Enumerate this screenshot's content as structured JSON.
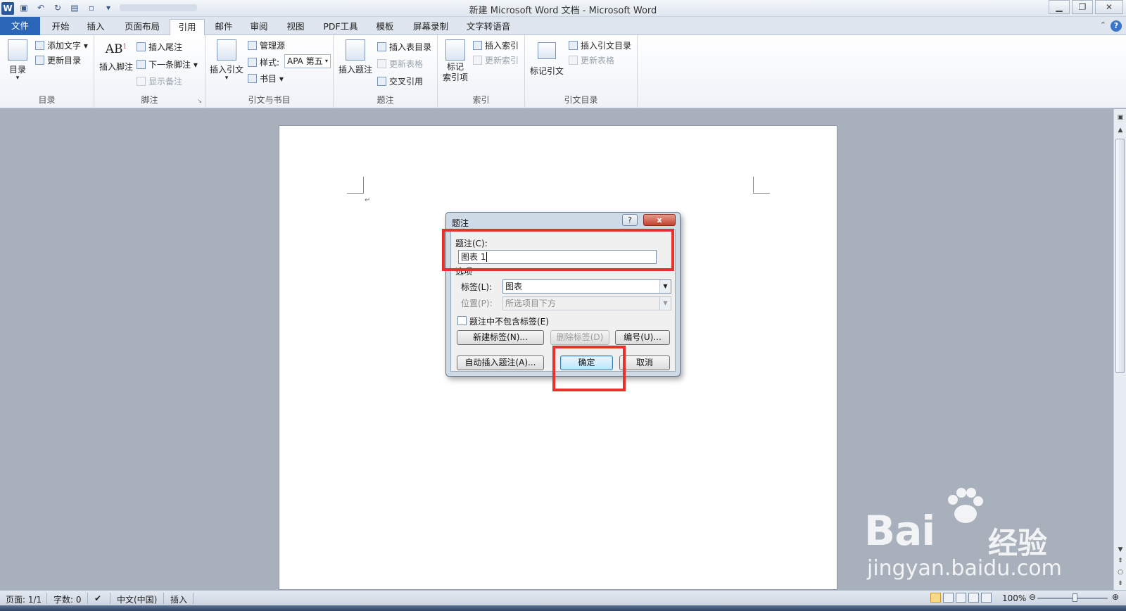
{
  "window": {
    "title": "新建 Microsoft Word 文档 - Microsoft Word",
    "app_icon": "W",
    "controls": [
      "minimize",
      "restore",
      "close"
    ]
  },
  "tabs": [
    {
      "label": "文件",
      "state": "file"
    },
    {
      "label": "开始"
    },
    {
      "label": "插入"
    },
    {
      "label": "页面布局"
    },
    {
      "label": "引用",
      "state": "active"
    },
    {
      "label": "邮件"
    },
    {
      "label": "审阅"
    },
    {
      "label": "视图"
    },
    {
      "label": "PDF工具"
    },
    {
      "label": "模板"
    },
    {
      "label": "屏幕录制"
    },
    {
      "label": "文字转语音"
    }
  ],
  "ribbon": {
    "toc": {
      "group": "目录",
      "toc_button": "目录",
      "add_text": "添加文字",
      "update_toc": "更新目录"
    },
    "footnotes": {
      "group": "脚注",
      "insert_footnote": "插入脚注",
      "ab_icon": "AB",
      "ab_sup": "1",
      "insert_endnote": "插入尾注",
      "next_footnote": "下一条脚注",
      "show_notes": "显示备注"
    },
    "citations": {
      "group": "引文与书目",
      "insert_citation": "插入引文",
      "manage_sources": "管理源",
      "style_label": "样式:",
      "style_value": "APA 第五",
      "bibliography": "书目"
    },
    "captions": {
      "group": "题注",
      "insert_caption": "插入题注",
      "insert_table_of_figures": "插入表目录",
      "update_table": "更新表格",
      "cross_reference": "交叉引用"
    },
    "index": {
      "group": "索引",
      "mark_entry_line1": "标记",
      "mark_entry_line2": "索引项",
      "insert_index": "插入索引",
      "update_index": "更新索引"
    },
    "toa": {
      "group": "引文目录",
      "mark_citation": "标记引文",
      "insert_toa": "插入引文目录",
      "update_table": "更新表格"
    }
  },
  "dialog": {
    "title": "题注",
    "help_button": "?",
    "close_button": "x",
    "caption_label": "题注(C):",
    "caption_value": "图表 1",
    "options_label": "选项",
    "label_label": "标签(L):",
    "label_value": "图表",
    "position_label": "位置(P):",
    "position_value": "所选项目下方",
    "exclude_label_checkbox": "题注中不包含标签(E)",
    "exclude_label_checked": false,
    "new_label_button": "新建标签(N)...",
    "delete_label_button": "删除标签(D)",
    "numbering_button": "编号(U)...",
    "autocaption_button": "自动插入题注(A)...",
    "ok_button": "确定",
    "cancel_button": "取消"
  },
  "highlight_color": "#e8302c",
  "status": {
    "page": "页面: 1/1",
    "words": "字数: 0",
    "language": "中文(中国)",
    "mode": "插入",
    "zoom": "100%",
    "zoom_level": 1.0
  },
  "watermark": {
    "brand": "Bai",
    "brand_suffix": "经验",
    "url": "jingyan.baidu.com"
  },
  "icons": {
    "save": "save-icon",
    "undo": "undo-icon",
    "redo": "redo-icon",
    "help": "help-icon"
  }
}
